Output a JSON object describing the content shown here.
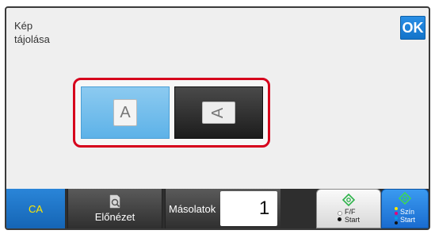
{
  "header": {
    "title": "Kép tájolása",
    "ok_label": "OK"
  },
  "orientation": {
    "portrait_glyph": "A",
    "landscape_glyph": "A",
    "selected": "portrait"
  },
  "bottom_bar": {
    "ca_label": "CA",
    "preview_label": "Előnézet",
    "copies_label": "Másolatok",
    "copies_value": "1",
    "bw_start": {
      "line1": "F/F",
      "line2": "Start"
    },
    "color_start": {
      "line1": "Szín",
      "line2": "Start"
    }
  },
  "colors": {
    "accent": "#1273c9",
    "selection_frame": "#d6001c",
    "start_icon": "#2db34a"
  },
  "icons": [
    "preview-icon",
    "start-diamond-icon"
  ]
}
